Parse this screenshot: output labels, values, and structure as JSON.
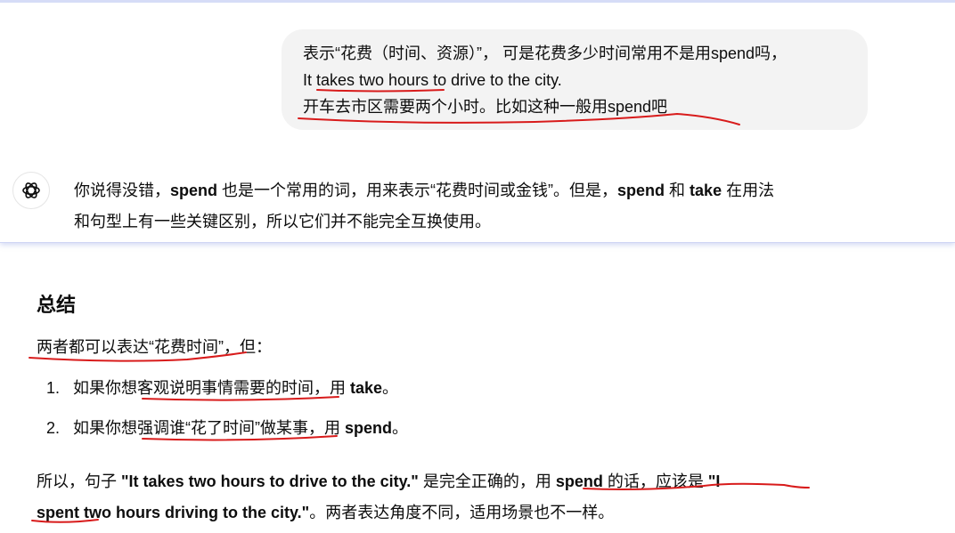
{
  "user_message": {
    "line1": "表示“花费（时间、资源）”， 可是花费多少时间常用不是用spend吗，",
    "line2": "It takes two hours to drive to the city.",
    "line3": "开车去市区需要两个小时。比如这种一般用spend吧"
  },
  "assistant_message": {
    "line1_a": "你说得没错，",
    "line1_b": "spend",
    "line1_c": " 也是一个常用的词，用来表示“花费时间或金钱”。但是，",
    "line1_d": "spend",
    "line1_e": " 和 ",
    "line1_f": "take",
    "line1_g": " 在用法",
    "line2": "和句型上有一些关键区别，所以它们并不能完全互换使用。",
    "avatar_icon": "openai-logo-icon"
  },
  "summary": {
    "title": "总结",
    "intro": "两者都可以表达“花费时间”，但：",
    "items": [
      {
        "num": "1.",
        "text_a": "如果你想客观说明事情需要的时间，用 ",
        "text_b": "take",
        "text_c": "。"
      },
      {
        "num": "2.",
        "text_a": "如果你想强调谁“花了时间”做某事，用 ",
        "text_b": "spend",
        "text_c": "。"
      }
    ],
    "para_line1_a": "所以，句子 ",
    "para_line1_b": "\"It takes two hours to drive to the city.\"",
    "para_line1_c": " 是完全正确的，用 ",
    "para_line1_d": "spend",
    "para_line1_e": " 的话，应该是 ",
    "para_line1_f": "\"I",
    "para_line2_a": "spent two hours driving to the city.\"",
    "para_line2_b": "。两者表达角度不同，适用场景也不一样。"
  },
  "colors": {
    "annotation_red": "#d81b1b",
    "bubble_bg": "#f3f3f3",
    "panel_border": "#cfd6f5"
  }
}
